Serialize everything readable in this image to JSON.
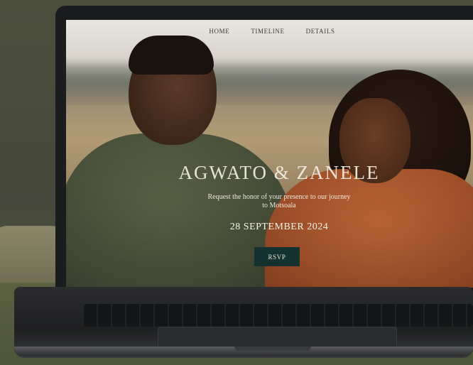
{
  "nav": {
    "items": [
      {
        "label": "HOME"
      },
      {
        "label": "TIMELINE"
      },
      {
        "label": "DETAILS"
      }
    ]
  },
  "hero": {
    "names": "AGWATO & ZANELE",
    "tagline": "Request the honor of your presence to our journey to Motsoala",
    "date": "28 SEPTEMBER 2024",
    "rsvp_label": "RSVP"
  },
  "colors": {
    "rsvp_button": "#14322f",
    "shirt_orange": "#a9552c",
    "shirt_olive": "#4a523a"
  }
}
